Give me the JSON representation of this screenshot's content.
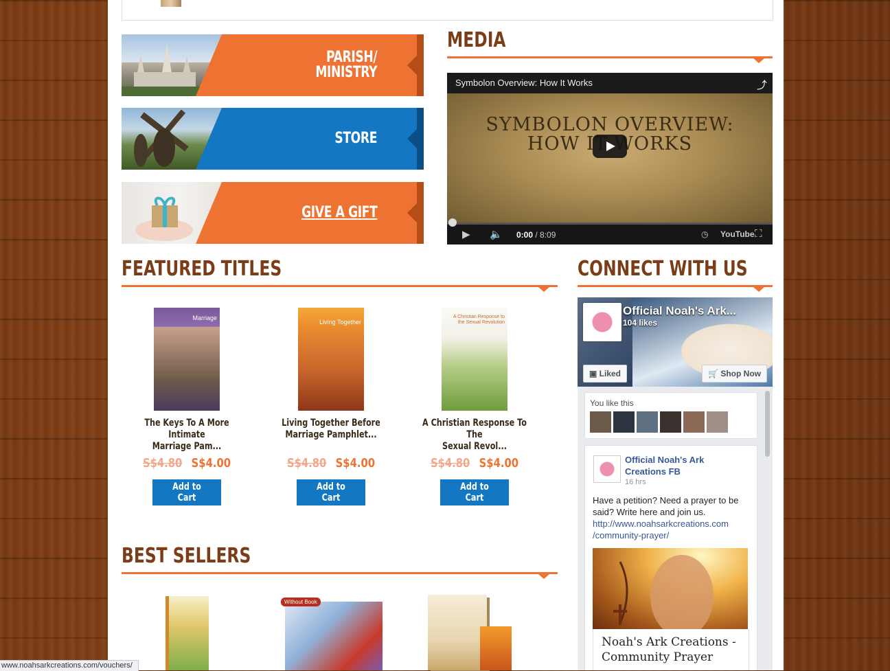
{
  "banners": [
    {
      "label_line1": "PARISH/",
      "label_line2": "MINISTRY"
    },
    {
      "label": "STORE"
    },
    {
      "label": "GIVE A GIFT"
    }
  ],
  "media": {
    "heading": "MEDIA",
    "video_title": "Symbolon Overview: How It Works",
    "frame_text_line1": "SYMBOLON OVERVIEW:",
    "frame_text_line2": "HOW IT WORKS",
    "time_current": "0:00",
    "time_total": "/ 8:09",
    "youtube_label": "YouTube"
  },
  "featured": {
    "heading": "FEATURED TITLES",
    "products": [
      {
        "title_line1": "The Keys To A More Intimate",
        "title_line2": "Marriage Pam...",
        "old_price": "S$4.80",
        "price": "S$4.00",
        "cart_label": "Add to Cart",
        "cover_text": "Marriage"
      },
      {
        "title_line1": "Living Together Before",
        "title_line2": "Marriage Pamphlet...",
        "old_price": "S$4.80",
        "price": "S$4.00",
        "cart_label": "Add to Cart",
        "cover_text": "Living Together"
      },
      {
        "title_line1": "A Christian Response To The",
        "title_line2": "Sexual Revol...",
        "old_price": "S$4.80",
        "price": "S$4.00",
        "cart_label": "Add to Cart",
        "cover_text": "A Christian Response to the Sexual Revolution"
      }
    ]
  },
  "bestsellers": {
    "heading": "BEST SELLERS",
    "badge": "Without Book"
  },
  "connect": {
    "heading": "CONNECT WITH US",
    "page_name": "Official Noah's Ark...",
    "likes": "104 likes",
    "liked_label": "Liked",
    "shop_label": "Shop Now",
    "you_like": "You like this",
    "post_page_line1": "Official Noah's Ark",
    "post_page_line2": "Creations FB",
    "post_time": "16 hrs",
    "post_text": "Have a petition? Need a prayer to be said? Write here and join us.",
    "post_link_line1": "http://www.noahsarkcreations.com",
    "post_link_line2": "/community-prayer/",
    "caption_line1": "Noah's Ark Creations -",
    "caption_line2": "Community Prayer"
  },
  "status_url": "www.noahsarkcreations.com/vouchers/"
}
